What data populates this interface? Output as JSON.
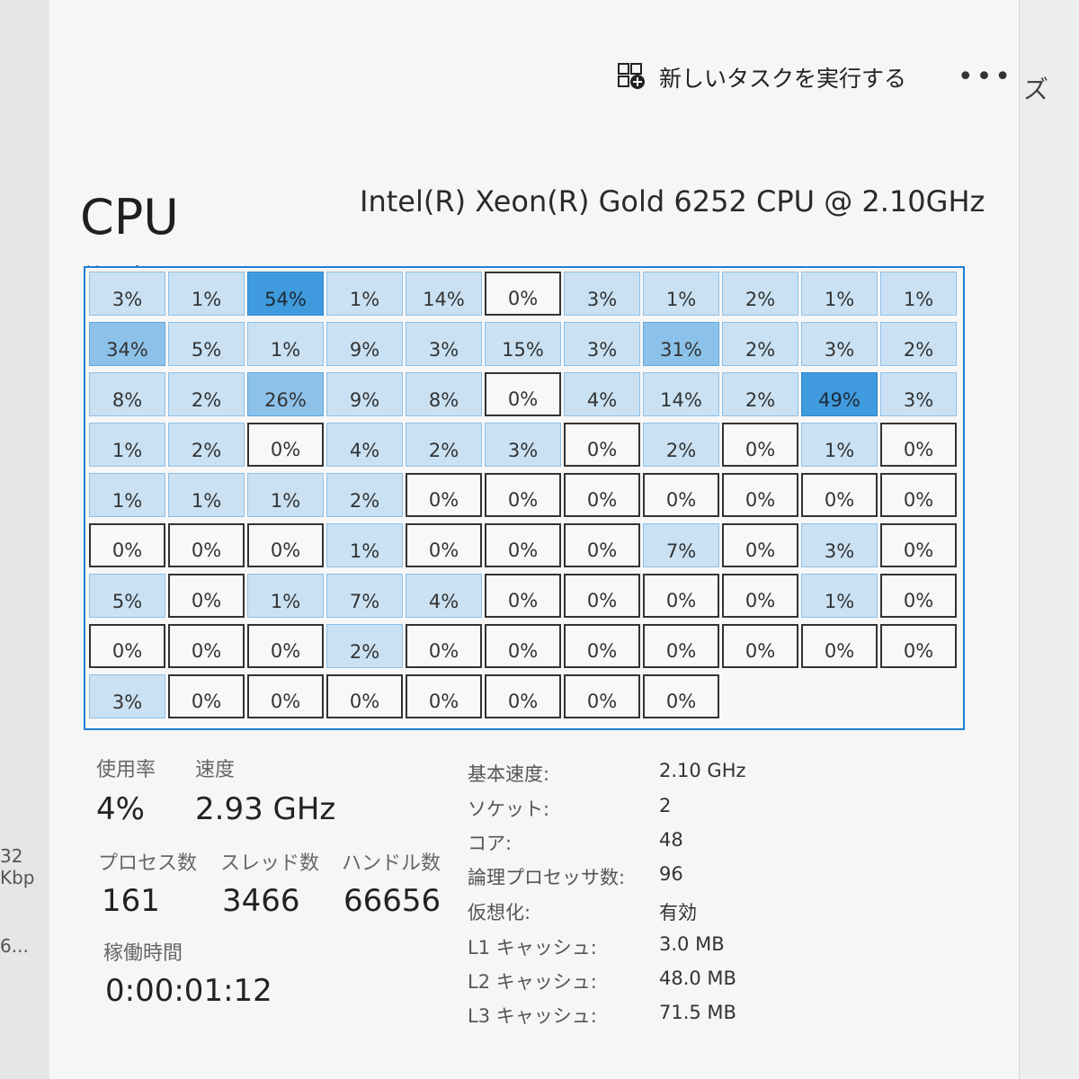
{
  "left_strip": {
    "bandwidth": "32 Kbp",
    "truncated": "6..."
  },
  "right_gutter": {
    "clipped_text": "ズ"
  },
  "toolbar": {
    "run_task_label": "新しいタスクを実行する",
    "more_label": "•••"
  },
  "header": {
    "title": "CPU",
    "model": "Intel(R) Xeon(R) Gold 6252 CPU @ 2.10GHz"
  },
  "grid": {
    "label": "論理プロセッサ",
    "rows": [
      [
        "3%",
        "1%",
        "54%",
        "1%",
        "14%",
        "0%",
        "3%",
        "1%",
        "2%",
        "1%",
        "1%"
      ],
      [
        "34%",
        "5%",
        "1%",
        "9%",
        "3%",
        "15%",
        "3%",
        "31%",
        "2%",
        "3%",
        "2%"
      ],
      [
        "8%",
        "2%",
        "26%",
        "9%",
        "8%",
        "0%",
        "4%",
        "14%",
        "2%",
        "49%",
        "3%"
      ],
      [
        "1%",
        "2%",
        "0%",
        "4%",
        "2%",
        "3%",
        "0%",
        "2%",
        "0%",
        "1%",
        "0%"
      ],
      [
        "1%",
        "1%",
        "1%",
        "2%",
        "0%",
        "0%",
        "0%",
        "0%",
        "0%",
        "0%",
        "0%"
      ],
      [
        "0%",
        "0%",
        "0%",
        "1%",
        "0%",
        "0%",
        "0%",
        "7%",
        "0%",
        "3%",
        "0%"
      ],
      [
        "5%",
        "0%",
        "1%",
        "7%",
        "4%",
        "0%",
        "0%",
        "0%",
        "0%",
        "1%",
        "0%"
      ],
      [
        "0%",
        "0%",
        "0%",
        "2%",
        "0%",
        "0%",
        "0%",
        "0%",
        "0%",
        "0%",
        "0%"
      ],
      [
        "3%",
        "0%",
        "0%",
        "0%",
        "0%",
        "0%",
        "0%",
        "0%"
      ]
    ]
  },
  "stats": {
    "usage_label": "使用率",
    "usage_value": "4%",
    "speed_label": "速度",
    "speed_value": "2.93 GHz",
    "processes_label": "プロセス数",
    "processes_value": "161",
    "threads_label": "スレッド数",
    "threads_value": "3466",
    "handles_label": "ハンドル数",
    "handles_value": "66656",
    "uptime_label": "稼働時間",
    "uptime_value": "0:00:01:12"
  },
  "specs": [
    {
      "key": "基本速度:",
      "value": "2.10 GHz"
    },
    {
      "key": "ソケット:",
      "value": "2"
    },
    {
      "key": "コア:",
      "value": "48"
    },
    {
      "key": "論理プロセッサ数:",
      "value": "96"
    },
    {
      "key": "仮想化:",
      "value": "有効"
    },
    {
      "key": "L1 キャッシュ:",
      "value": "3.0 MB"
    },
    {
      "key": "L2 キャッシュ:",
      "value": "48.0 MB"
    },
    {
      "key": "L3 キャッシュ:",
      "value": "71.5 MB"
    }
  ]
}
